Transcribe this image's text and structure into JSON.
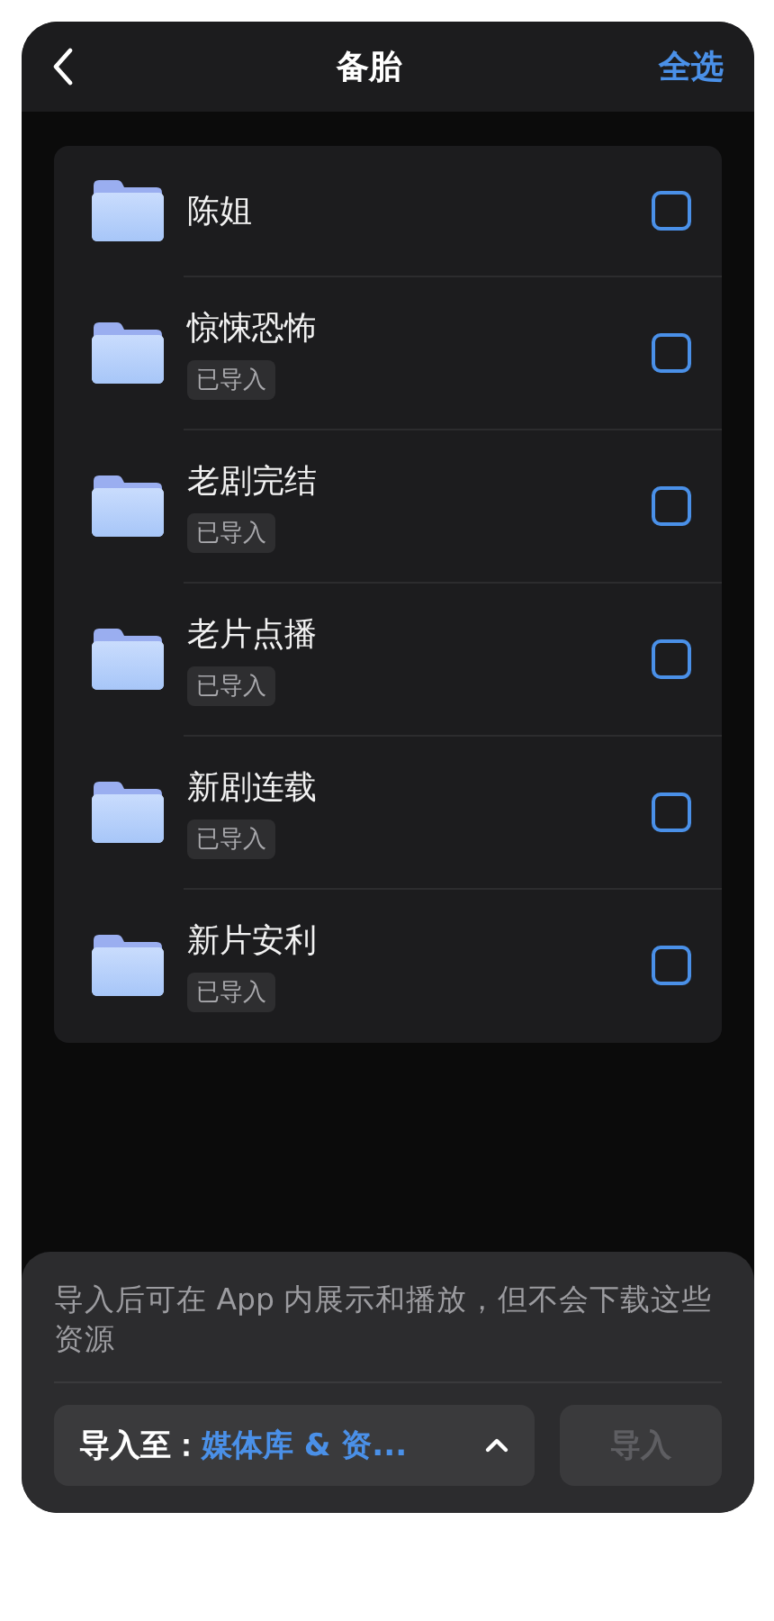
{
  "nav": {
    "title": "备胎",
    "action": "全选"
  },
  "folders": [
    {
      "name": "陈姐",
      "checked": false
    },
    {
      "name": "惊悚恐怖",
      "badge": "已导入",
      "checked": false
    },
    {
      "name": "老剧完结",
      "badge": "已导入",
      "checked": false
    },
    {
      "name": "老片点播",
      "badge": "已导入",
      "checked": false
    },
    {
      "name": "新剧连载",
      "badge": "已导入",
      "checked": false
    },
    {
      "name": "新片安利",
      "badge": "已导入",
      "checked": false
    }
  ],
  "sheet": {
    "note": "导入后可在 App 内展示和播放，但不会下载这些资源",
    "destination_label": "导入至：",
    "destination_value": "媒体库 & 资...",
    "import_button": {
      "label": "导入",
      "disabled": true
    }
  }
}
